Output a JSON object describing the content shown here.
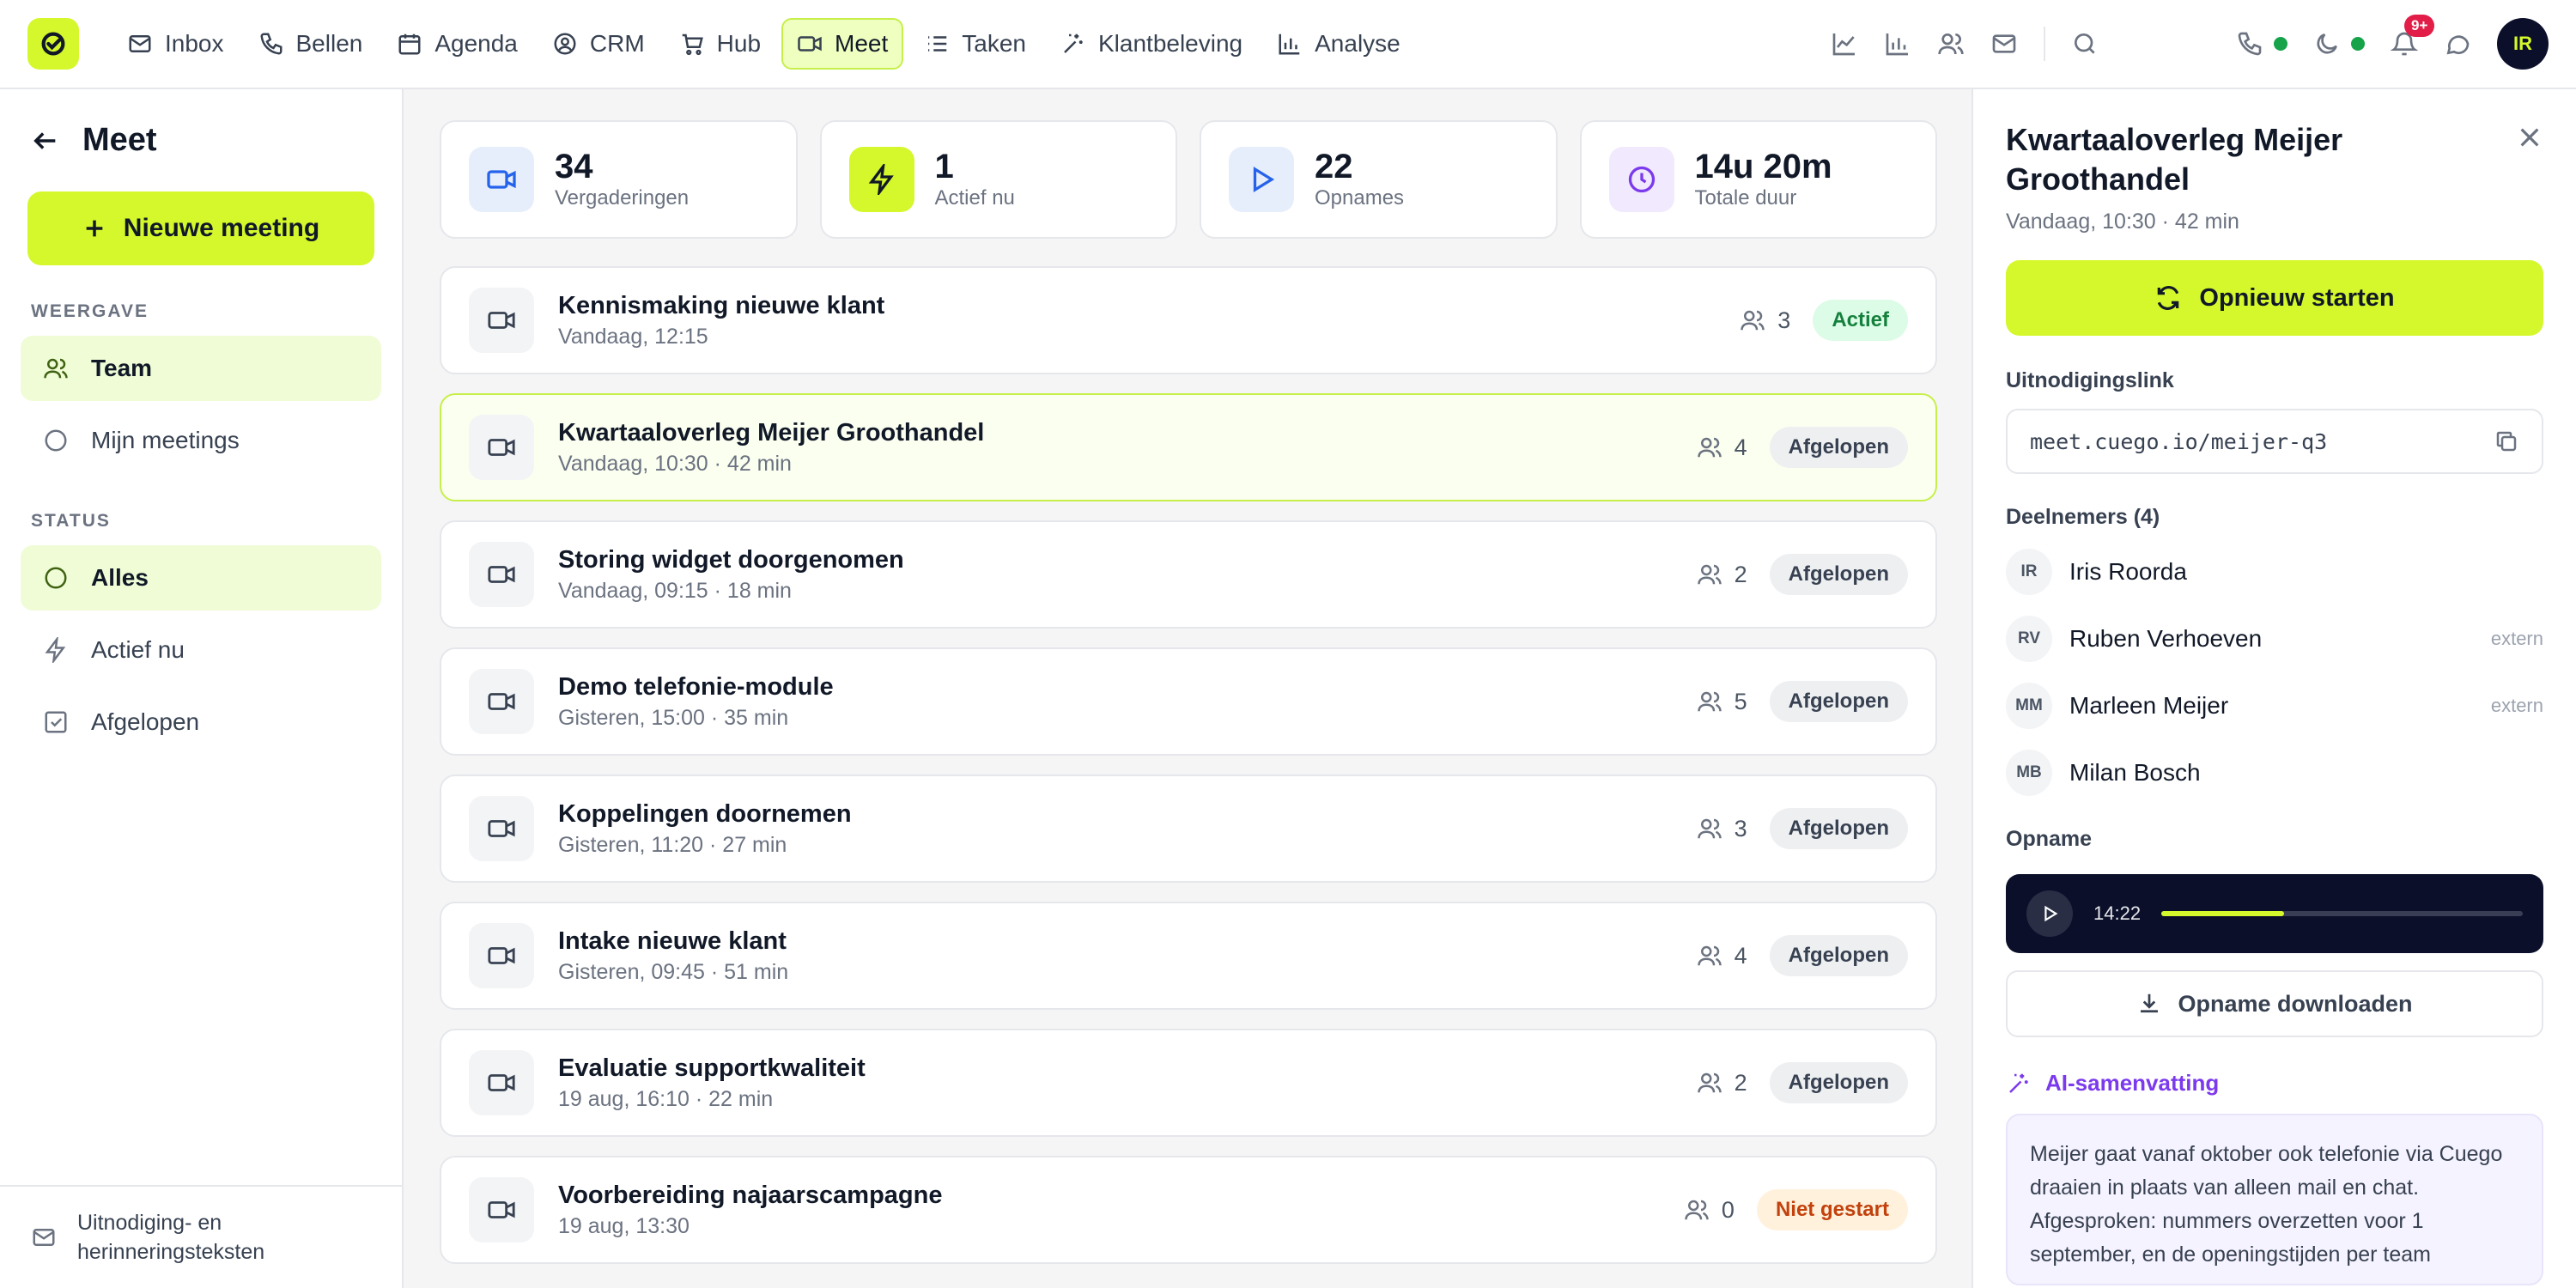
{
  "topbar": {
    "nav": [
      {
        "label": "Inbox",
        "icon": "mail-icon"
      },
      {
        "label": "Bellen",
        "icon": "phone-icon"
      },
      {
        "label": "Agenda",
        "icon": "calendar-icon"
      },
      {
        "label": "CRM",
        "icon": "contact-icon"
      },
      {
        "label": "Hub",
        "icon": "cart-icon"
      },
      {
        "label": "Meet",
        "icon": "video-icon",
        "active": true
      },
      {
        "label": "Taken",
        "icon": "list-icon"
      },
      {
        "label": "Klantbeleving",
        "icon": "sparkle-icon"
      },
      {
        "label": "Analyse",
        "icon": "bar-chart-icon"
      }
    ],
    "notification_badge": "9+",
    "avatar_initials": "IR",
    "accent_color": "#d4f82b"
  },
  "sidebar": {
    "title": "Meet",
    "new_button": "Nieuwe meeting",
    "view_section": "WEERGAVE",
    "view_items": [
      {
        "label": "Team",
        "active": true
      },
      {
        "label": "Mijn meetings",
        "active": false
      }
    ],
    "status_section": "STATUS",
    "status_items": [
      {
        "label": "Alles",
        "active": true
      },
      {
        "label": "Actief nu",
        "active": false
      },
      {
        "label": "Afgelopen",
        "active": false
      }
    ],
    "footer_line1": "Uitnodiging- en",
    "footer_line2": "herinneringsteksten"
  },
  "stats": [
    {
      "value": "34",
      "label": "Vergaderingen"
    },
    {
      "value": "1",
      "label": "Actief nu"
    },
    {
      "value": "22",
      "label": "Opnames"
    },
    {
      "value": "14u 20m",
      "label": "Totale duur"
    }
  ],
  "meetings": [
    {
      "title": "Kennismaking nieuwe klant",
      "sub": "Vandaag, 12:15",
      "count": "3",
      "status": "Actief",
      "kind": "actief"
    },
    {
      "title": "Kwartaaloverleg Meijer Groothandel",
      "sub": "Vandaag, 10:30 · 42 min",
      "count": "4",
      "status": "Afgelopen",
      "kind": "afgelopen",
      "selected": true
    },
    {
      "title": "Storing widget doorgenomen",
      "sub": "Vandaag, 09:15 · 18 min",
      "count": "2",
      "status": "Afgelopen",
      "kind": "afgelopen"
    },
    {
      "title": "Demo telefonie-module",
      "sub": "Gisteren, 15:00 · 35 min",
      "count": "5",
      "status": "Afgelopen",
      "kind": "afgelopen"
    },
    {
      "title": "Koppelingen doornemen",
      "sub": "Gisteren, 11:20 · 27 min",
      "count": "3",
      "status": "Afgelopen",
      "kind": "afgelopen"
    },
    {
      "title": "Intake nieuwe klant",
      "sub": "Gisteren, 09:45 · 51 min",
      "count": "4",
      "status": "Afgelopen",
      "kind": "afgelopen"
    },
    {
      "title": "Evaluatie supportkwaliteit",
      "sub": "19 aug, 16:10 · 22 min",
      "count": "2",
      "status": "Afgelopen",
      "kind": "afgelopen"
    },
    {
      "title": "Voorbereiding najaarscampagne",
      "sub": "19 aug, 13:30",
      "count": "0",
      "status": "Niet gestart",
      "kind": "niet"
    }
  ],
  "detail": {
    "title": "Kwartaaloverleg Meijer Groothandel",
    "sub": "Vandaag, 10:30 · 42 min",
    "restart_label": "Opnieuw starten",
    "link_label": "Uitnodigingslink",
    "link": "meet.cuego.io/meijer-q3",
    "participants_label": "Deelnemers (4)",
    "participants": [
      {
        "initials": "IR",
        "name": "Iris Roorda",
        "ext": ""
      },
      {
        "initials": "RV",
        "name": "Ruben Verhoeven",
        "ext": "extern"
      },
      {
        "initials": "MM",
        "name": "Marleen Meijer",
        "ext": "extern"
      },
      {
        "initials": "MB",
        "name": "Milan Bosch",
        "ext": ""
      }
    ],
    "recording_label": "Opname",
    "recording_time": "14:22",
    "recording_progress": 0.34,
    "download_label": "Opname downloaden",
    "ai_label": "AI-samenvatting",
    "ai_text": "Meijer gaat vanaf oktober ook telefonie via Cuego draaien in plaats van alleen mail en chat. Afgesproken: nummers overzetten voor 1 september, en de openingstijden per team"
  }
}
